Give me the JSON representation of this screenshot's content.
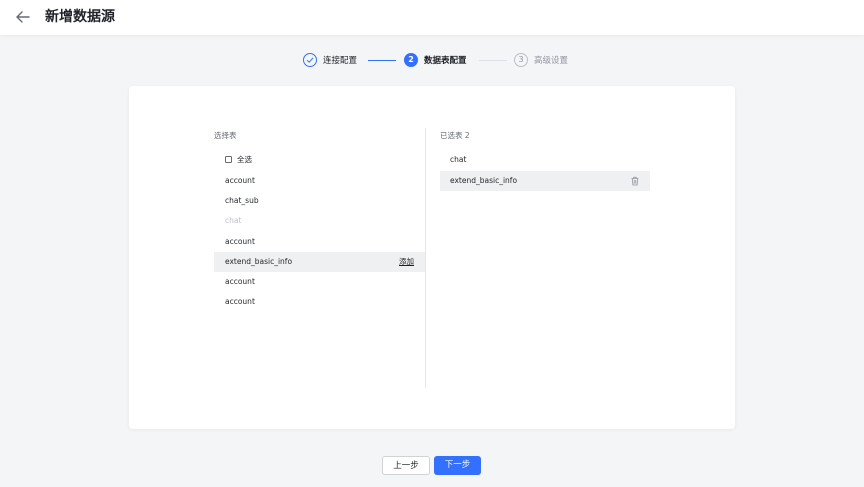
{
  "header": {
    "title": "新增数据源",
    "back_icon": "arrow-left-icon"
  },
  "steps": [
    {
      "number": "1",
      "label": "连接配置",
      "state": "done"
    },
    {
      "number": "2",
      "label": "数据表配置",
      "state": "active"
    },
    {
      "number": "3",
      "label": "高级设置",
      "state": "todo"
    }
  ],
  "left_panel": {
    "title": "选择表",
    "select_all_label": "全选",
    "add_label": "添加",
    "rows": [
      {
        "name": "account",
        "disabled": false
      },
      {
        "name": "chat_sub",
        "disabled": false
      },
      {
        "name": "chat",
        "disabled": true
      },
      {
        "name": "account",
        "disabled": false
      },
      {
        "name": "extend_basic_info",
        "disabled": false,
        "hovered": true
      },
      {
        "name": "account",
        "disabled": false
      },
      {
        "name": "account",
        "disabled": false
      }
    ]
  },
  "right_panel": {
    "title": "已选表 2",
    "rows": [
      {
        "name": "chat"
      },
      {
        "name": "extend_basic_info",
        "hovered": true
      }
    ]
  },
  "footer": {
    "prev_label": "上一步",
    "next_label": "下一步"
  },
  "colors": {
    "primary": "#3370ff",
    "background": "#f4f5f7",
    "hover_row": "#eff0f1",
    "disabled_text": "#bbbfc4"
  }
}
